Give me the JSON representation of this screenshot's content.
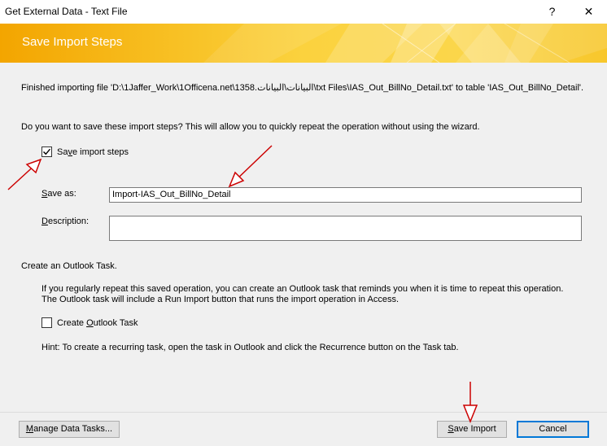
{
  "window": {
    "title": "Get External Data - Text File",
    "help_label": "?",
    "close_label": "✕"
  },
  "banner": {
    "title": "Save Import Steps",
    "accent_color": "#f7bd1f"
  },
  "status_message": "Finished importing file 'D:\\1Jaffer_Work\\1Officena.net\\1358.البيانات\\البيانات\\txt Files\\IAS_Out_BillNo_Detail.txt' to table 'IAS_Out_BillNo_Detail'.",
  "prompt": "Do you want to save these import steps? This will allow you to quickly repeat the operation without using the wizard.",
  "save_steps": {
    "checked": true,
    "label_pre": "Sa",
    "label_key": "v",
    "label_post": "e import steps"
  },
  "save_as": {
    "label_pre": "",
    "label_key": "S",
    "label_post": "ave as:",
    "value": "Import-IAS_Out_BillNo_Detail"
  },
  "description": {
    "label_pre": "",
    "label_key": "D",
    "label_post": "escription:",
    "value": ""
  },
  "outlook": {
    "section_title": "Create an Outlook Task.",
    "info_line1": "If you regularly repeat this saved operation, you can create an Outlook task that reminds you when it is time to repeat this operation.",
    "info_line2": "The Outlook task will include a Run Import button that runs the import operation in Access.",
    "create_task": {
      "checked": false,
      "label_pre": "Create ",
      "label_key": "O",
      "label_post": "utlook Task"
    },
    "hint": "Hint: To create a recurring task, open the task in Outlook and click the Recurrence button on the Task tab."
  },
  "buttons": {
    "manage": {
      "label_pre": "",
      "label_key": "M",
      "label_post": "anage Data Tasks..."
    },
    "save_import": {
      "label_pre": "",
      "label_key": "S",
      "label_post": "ave Import"
    },
    "cancel": {
      "label": "Cancel"
    }
  },
  "annotation_color": "#cc0000"
}
